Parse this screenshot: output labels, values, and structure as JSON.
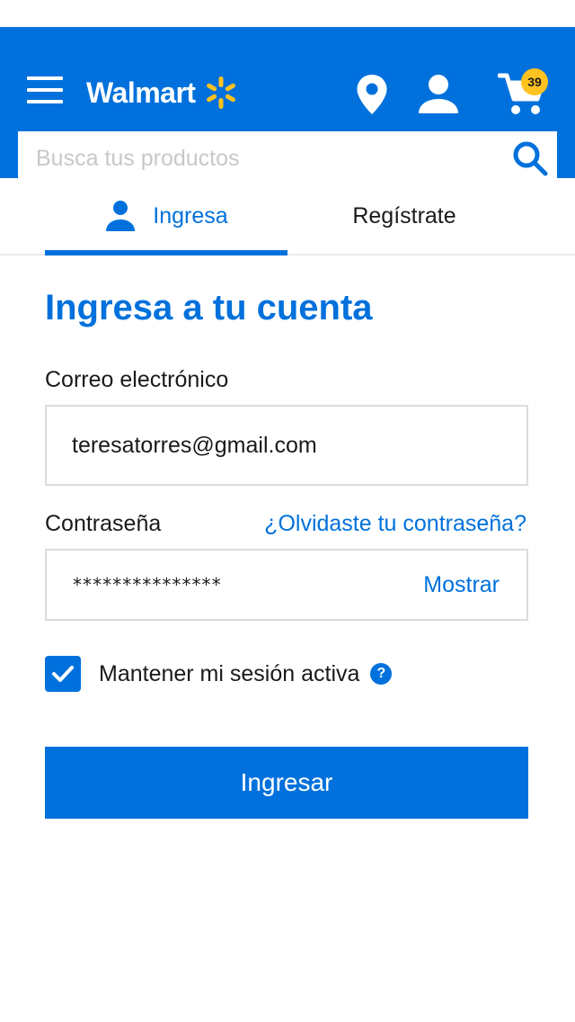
{
  "header": {
    "logo_text": "Walmart",
    "cart_count": "39",
    "icons": [
      "menu-icon",
      "spark-icon",
      "location-pin-icon",
      "user-icon",
      "cart-icon",
      "search-icon"
    ],
    "colors": {
      "brand_blue": "#0071dc",
      "spark_yellow": "#ffc220"
    }
  },
  "search": {
    "placeholder": "Busca tus productos",
    "value": ""
  },
  "tabs": [
    {
      "label": "Ingresa",
      "active": true
    },
    {
      "label": "Regístrate",
      "active": false
    }
  ],
  "form": {
    "title": "Ingresa a tu cuenta",
    "email_label": "Correo electrónico",
    "email_value": "teresatorres@gmail.com",
    "password_label": "Contraseña",
    "forgot_link": "¿Olvidaste tu contraseña?",
    "password_value": "***************",
    "show_label": "Mostrar",
    "remember_label": "Mantener mi sesión activa",
    "remember_checked": true,
    "help_glyph": "?",
    "submit_label": "Ingresar"
  }
}
